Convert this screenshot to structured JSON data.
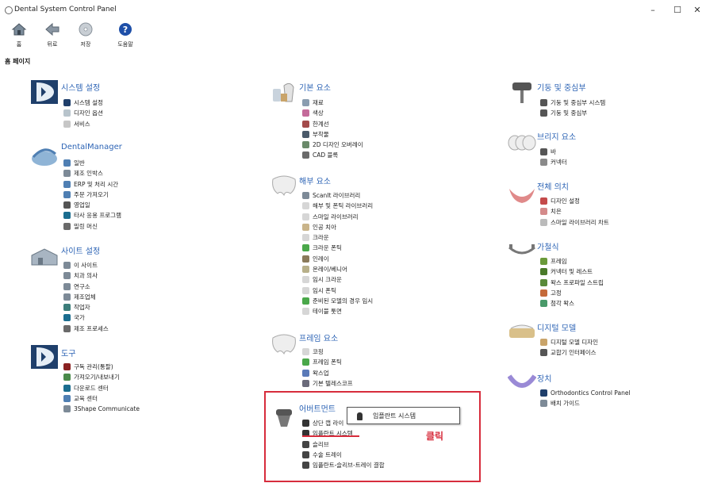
{
  "window": {
    "title": "Dental System Control Panel",
    "minimize": "–",
    "maximize": "☐",
    "close": "✕"
  },
  "toolbar": [
    {
      "label": "홈",
      "icon": "home-icon",
      "color": "#7a8a99"
    },
    {
      "label": "뒤로",
      "icon": "back-arrow-icon",
      "color": "#8a96a3"
    },
    {
      "label": "저장",
      "icon": "save-disc-icon",
      "color": "#9aa4ae"
    },
    {
      "label": "도움말",
      "icon": "help-icon",
      "color": "#1e4fa8"
    }
  ],
  "breadcrumb": "홈 페이지",
  "categories": [
    {
      "title": "시스템 설정",
      "icon": "system-settings-icon",
      "items": [
        {
          "label": "시스템 설정",
          "color": "#1f3f6b"
        },
        {
          "label": "디자인 옵션",
          "color": "#b8c4cc"
        },
        {
          "label": "서비스",
          "color": "#c6c6c6"
        }
      ]
    },
    {
      "title": "DentalManager",
      "icon": "dental-manager-icon",
      "items": [
        {
          "label": "일반",
          "color": "#4f7fb3"
        },
        {
          "label": "제조 인박스",
          "color": "#7d8a97"
        },
        {
          "label": "ERP 및 처리 시간",
          "color": "#4f7fb3"
        },
        {
          "label": "주문 가져오기",
          "color": "#4f7fb3"
        },
        {
          "label": "영업일",
          "color": "#555555"
        },
        {
          "label": "타사 응용 프로그램",
          "color": "#1b6d8f"
        },
        {
          "label": "밀링 머신",
          "color": "#6a6a6a"
        }
      ]
    },
    {
      "title": "사이트 설정",
      "icon": "site-settings-icon",
      "items": [
        {
          "label": "이 사이트",
          "color": "#7d8a97"
        },
        {
          "label": "치과 의사",
          "color": "#7d8a97"
        },
        {
          "label": "연구소",
          "color": "#7d8a97"
        },
        {
          "label": "제조업체",
          "color": "#7d8a97"
        },
        {
          "label": "작업자",
          "color": "#3c7d7a"
        },
        {
          "label": "국가",
          "color": "#1b6d8f"
        },
        {
          "label": "제조 프로세스",
          "color": "#6a6a6a"
        }
      ]
    },
    {
      "title": "도구",
      "icon": "tools-icon",
      "items": [
        {
          "label": "구독 관리(통팔)",
          "color": "#8a2222"
        },
        {
          "label": "가져오기/내보내기",
          "color": "#4a8a4a"
        },
        {
          "label": "다운로드 센터",
          "color": "#1b6d8f"
        },
        {
          "label": "교육 센터",
          "color": "#4f7fb3"
        },
        {
          "label": "3Shape Communicate",
          "color": "#7d8a97"
        }
      ]
    },
    {
      "title": "기본 요소",
      "icon": "basic-elements-icon",
      "items": [
        {
          "label": "재료",
          "color": "#8a9db0"
        },
        {
          "label": "색상",
          "color": "#c46a9a"
        },
        {
          "label": "한계선",
          "color": "#a34a4a"
        },
        {
          "label": "부착물",
          "color": "#4a5a6a"
        },
        {
          "label": "2D 디자인 오버레이",
          "color": "#6a8a6a"
        },
        {
          "label": "CAD 블록",
          "color": "#6a6a6a"
        }
      ]
    },
    {
      "title": "해부 요소",
      "icon": "anatomy-elements-icon",
      "items": [
        {
          "label": "ScanIt 라이브러리",
          "color": "#7d8a97"
        },
        {
          "label": "해부 및 폰틱 라이브러리",
          "color": "#d6d6d6"
        },
        {
          "label": "스마일 라이브러리",
          "color": "#d6d6d6"
        },
        {
          "label": "인공 치아",
          "color": "#c9b48a"
        },
        {
          "label": "크라운",
          "color": "#d6d6d6"
        },
        {
          "label": "크라운 폰틱",
          "color": "#4aa84a"
        },
        {
          "label": "인레이",
          "color": "#8a7a5a"
        },
        {
          "label": "온레이/베니어",
          "color": "#b8b08a"
        },
        {
          "label": "임시 크라운",
          "color": "#d6d6d6"
        },
        {
          "label": "임시 폰틱",
          "color": "#d6d6d6"
        },
        {
          "label": "준비된 모델의 경우 임시",
          "color": "#4aa84a"
        },
        {
          "label": "테이블 톳면",
          "color": "#d6d6d6"
        }
      ]
    },
    {
      "title": "프레임 요소",
      "icon": "frame-elements-icon",
      "items": [
        {
          "label": "코핑",
          "color": "#d6d6d6"
        },
        {
          "label": "프레임 폰틱",
          "color": "#4aa84a"
        },
        {
          "label": "왁스업",
          "color": "#5a7ab8"
        },
        {
          "label": "기본 텔레스코프",
          "color": "#6a6a7a"
        }
      ]
    },
    {
      "title": "어버트먼트",
      "icon": "abutment-icon",
      "items": [
        {
          "label": "상단 캡 라이",
          "color": "#333333"
        },
        {
          "label": "임플란트 시스템",
          "color": "#333333"
        },
        {
          "label": "슬리브",
          "color": "#444444"
        },
        {
          "label": "수술 트레이",
          "color": "#444444"
        },
        {
          "label": "임플란트-슬리브-트레이 결합",
          "color": "#444444"
        }
      ]
    },
    {
      "title": "기둥 및 중심부",
      "icon": "post-core-icon",
      "items": [
        {
          "label": "기둥 및 중심부 시스템",
          "color": "#555555"
        },
        {
          "label": "기둥 및 중심부",
          "color": "#555555"
        }
      ]
    },
    {
      "title": "브리지 요소",
      "icon": "bridge-elements-icon",
      "items": [
        {
          "label": "바",
          "color": "#555555"
        },
        {
          "label": "커넥터",
          "color": "#8a8a8a"
        }
      ]
    },
    {
      "title": "전체 의치",
      "icon": "full-denture-icon",
      "items": [
        {
          "label": "디자인 설정",
          "color": "#c44a4a"
        },
        {
          "label": "치은",
          "color": "#d48a8a"
        },
        {
          "label": "스마일 라이브러리 차트",
          "color": "#bbbbbb"
        }
      ]
    },
    {
      "title": "가철식",
      "icon": "removable-icon",
      "items": [
        {
          "label": "프레임",
          "color": "#6a9a3a"
        },
        {
          "label": "커넥터 및 레스트",
          "color": "#4a7a2a"
        },
        {
          "label": "왁스 프로파일 스트립",
          "color": "#5a8a3a"
        },
        {
          "label": "고정",
          "color": "#c46a3a"
        },
        {
          "label": "첨각 왁스",
          "color": "#4a9a6a"
        }
      ]
    },
    {
      "title": "디지털 모델",
      "icon": "digital-model-icon",
      "items": [
        {
          "label": "디지털 모델 디자인",
          "color": "#c9a46a"
        },
        {
          "label": "교합기 인터페이스",
          "color": "#555555"
        }
      ]
    },
    {
      "title": "장치",
      "icon": "appliance-icon",
      "items": [
        {
          "label": "Orthodontics Control Panel",
          "color": "#1f3f6b"
        },
        {
          "label": "배치 가이드",
          "color": "#7d8a97"
        }
      ]
    }
  ],
  "popup": {
    "label": "임플란트 시스템"
  },
  "annotation": {
    "click_label": "클릭",
    "highlight_color": "#d72c3c"
  }
}
